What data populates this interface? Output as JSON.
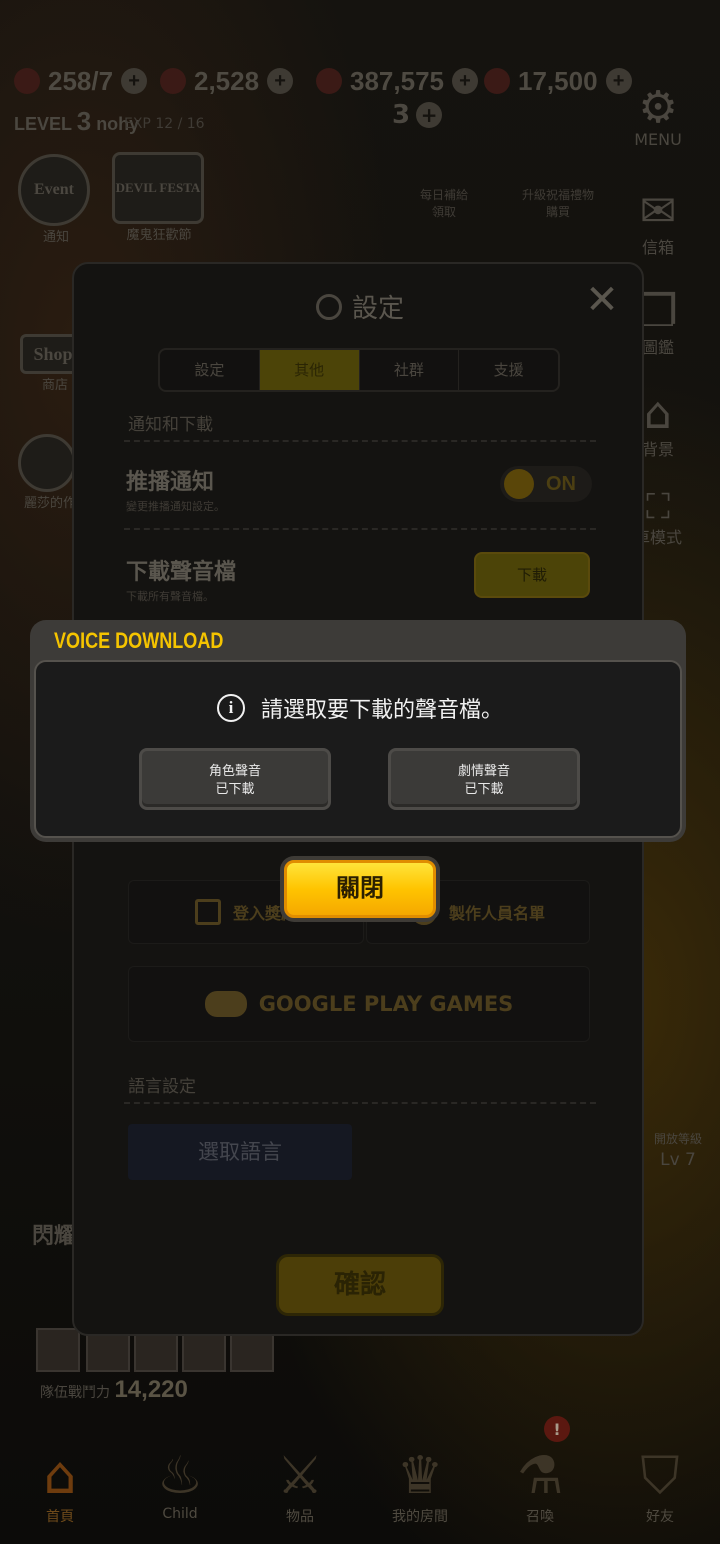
{
  "background": {
    "resources": [
      "258/7",
      "2,528",
      "387,575",
      "17,500"
    ],
    "level_label": "LEVEL",
    "level_value": "3",
    "player_name": "nohy",
    "exp": "EXP 12 / 16",
    "stamina": "3",
    "side_menu": [
      {
        "label": "MENU"
      },
      {
        "label": "信箱"
      },
      {
        "label": "圖鑑"
      },
      {
        "label": "背景"
      },
      {
        "label": "車模式"
      }
    ],
    "left_icons": [
      {
        "label": "通知",
        "badge": "Event"
      },
      {
        "label": "魔鬼狂歡節",
        "badge": "DEVIL FESTA"
      },
      {
        "label": "商店",
        "badge": "Shop"
      },
      {
        "label": "麗莎的作"
      }
    ],
    "promo_labels": [
      "每日補給\n領取",
      "升級祝福禮物\n購買"
    ],
    "locked_label": "開放等級",
    "locked_level": "Lv 7",
    "flash_label": "閃耀",
    "team_power_label": "隊伍戰鬥力",
    "team_power_value": "14,220",
    "nav": [
      {
        "label": "首頁",
        "glyph": "⌂",
        "active": true
      },
      {
        "label": "Child",
        "glyph": "♨"
      },
      {
        "label": "物品",
        "glyph": "⚔"
      },
      {
        "label": "我的房間",
        "glyph": "♛"
      },
      {
        "label": "召喚",
        "glyph": "⚗",
        "alert": "!"
      },
      {
        "label": "好友",
        "glyph": "⛉"
      }
    ]
  },
  "settings": {
    "title": "設定",
    "tabs": [
      "設定",
      "其他",
      "社群",
      "支援"
    ],
    "active_tab": "其他",
    "section_notify": "通知和下載",
    "push_title": "推播通知",
    "push_sub": "變更推播通知設定。",
    "push_state": "ON",
    "voice_title": "下載聲音檔",
    "voice_sub": "下載所有聲音檔。",
    "download_label": "下載",
    "login_label": "登入獎勵",
    "credits_label": "製作人員名單",
    "google_label": "GOOGLE PLAY GAMES",
    "section_lang": "語言設定",
    "lang_select": "選取語言",
    "confirm_label": "確認"
  },
  "dialog": {
    "title": "VOICE DOWNLOAD",
    "message": "請選取要下載的聲音檔。",
    "options": [
      {
        "title": "角色聲音",
        "status": "已下載"
      },
      {
        "title": "劇情聲音",
        "status": "已下載"
      }
    ],
    "close_label": "關閉"
  },
  "colors": {
    "accent_yellow": "#ffc400",
    "dialog_title": "#f5c400",
    "dialog_bg": "#1b1b1b"
  }
}
